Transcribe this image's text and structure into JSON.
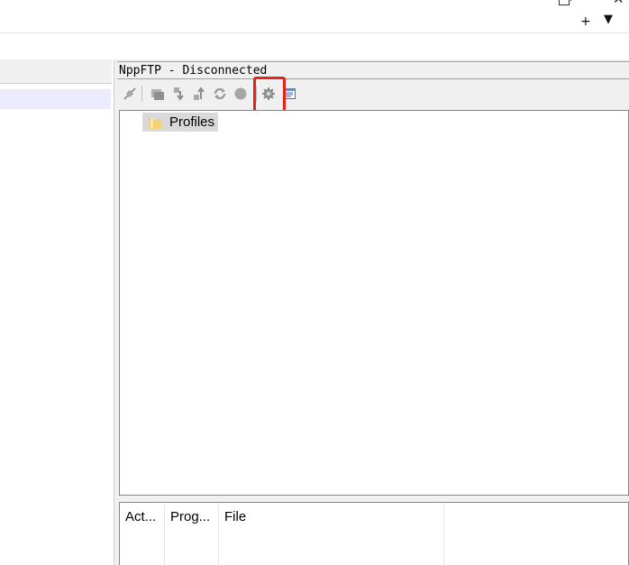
{
  "window": {
    "restore_icon": "restore-icon",
    "close_glyph": "✕",
    "add_tab_glyph": "+",
    "tab_list_glyph": "▼"
  },
  "ftp_panel": {
    "title": "NppFTP - Disconnected",
    "toolbar": [
      {
        "name": "connect-icon",
        "tooltip": "Connect"
      },
      {
        "name": "open-directory-icon",
        "tooltip": "Open directory"
      },
      {
        "name": "download-icon",
        "tooltip": "Download"
      },
      {
        "name": "upload-icon",
        "tooltip": "Upload"
      },
      {
        "name": "refresh-icon",
        "tooltip": "Refresh"
      },
      {
        "name": "abort-icon",
        "tooltip": "Abort"
      },
      {
        "name": "settings-icon",
        "tooltip": "Settings"
      },
      {
        "name": "message-window-icon",
        "tooltip": "Show NppFTP Window"
      }
    ],
    "highlight_color": "#e8221b",
    "tree": {
      "root_label": "Profiles"
    },
    "queue": {
      "columns": [
        "Act...",
        "Prog...",
        "File"
      ]
    }
  }
}
